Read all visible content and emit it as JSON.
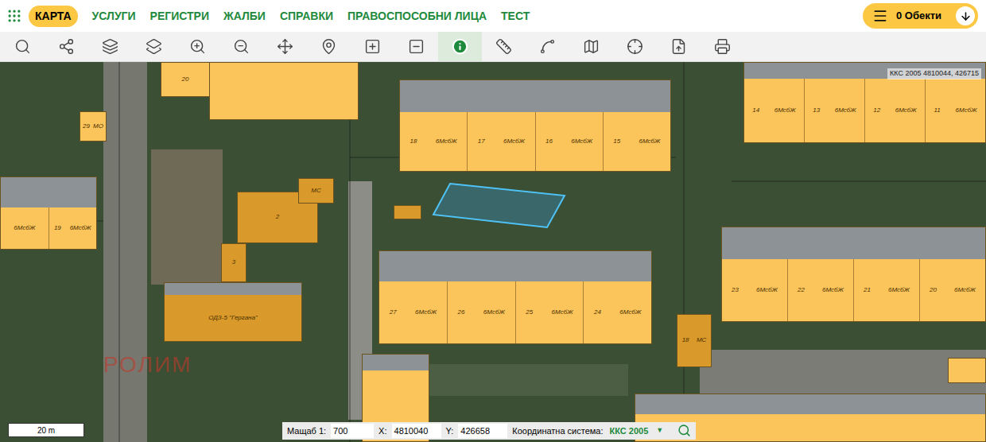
{
  "nav": {
    "items": [
      {
        "label": "КАРТА",
        "selected": true
      },
      {
        "label": "УСЛУГИ",
        "selected": false
      },
      {
        "label": "РЕГИСТРИ",
        "selected": false
      },
      {
        "label": "ЖАЛБИ",
        "selected": false
      },
      {
        "label": "СПРАВКИ",
        "selected": false
      },
      {
        "label": "ПРАВОСПОСОБНИ ЛИЦА",
        "selected": false
      },
      {
        "label": "ТЕСТ",
        "selected": false
      }
    ],
    "objects_button": {
      "label": "0 Обекти"
    }
  },
  "toolbar": {
    "tools": [
      {
        "selected": false
      },
      {
        "selected": false
      },
      {
        "selected": false
      },
      {
        "selected": false
      },
      {
        "selected": false
      },
      {
        "selected": false
      },
      {
        "selected": false
      },
      {
        "selected": false
      },
      {
        "selected": false
      },
      {
        "selected": false
      },
      {
        "selected": true
      },
      {
        "selected": false
      },
      {
        "selected": false
      },
      {
        "selected": false
      },
      {
        "selected": false
      },
      {
        "selected": false
      },
      {
        "selected": false
      }
    ]
  },
  "map": {
    "coordinates": "ККС 2005 4810044, 426715",
    "watermark": "РОЛИМ",
    "selected_parcel": {
      "highlighted": true
    },
    "buildings": [
      {
        "kind": "residential",
        "sections": [
          {
            "texts": [
              "18",
              "6МсбЖ"
            ]
          },
          {
            "texts": [
              "17",
              "6МсбЖ"
            ]
          },
          {
            "texts": [
              "16",
              "6МсбЖ"
            ]
          },
          {
            "texts": [
              "15",
              "6МсбЖ"
            ]
          }
        ]
      },
      {
        "kind": "residential",
        "sections": [
          {
            "texts": [
              "14",
              "6МсбЖ"
            ]
          },
          {
            "texts": [
              "13",
              "6МсбЖ"
            ]
          },
          {
            "texts": [
              "12",
              "6МсбЖ"
            ]
          },
          {
            "texts": [
              "11",
              "6МсбЖ"
            ]
          }
        ]
      },
      {
        "kind": "residential",
        "sections": [
          {
            "texts": [
              "6МсбЖ"
            ]
          },
          {
            "texts": [
              "19",
              "6МсбЖ"
            ]
          }
        ]
      },
      {
        "kind": "residential",
        "sections": [
          {
            "texts": [
              "27",
              "6МсбЖ"
            ]
          },
          {
            "texts": [
              "26",
              "6МсбЖ"
            ]
          },
          {
            "texts": [
              "25",
              "6МсбЖ"
            ]
          },
          {
            "texts": [
              "24",
              "6МсбЖ"
            ]
          }
        ]
      },
      {
        "kind": "residential",
        "sections": [
          {
            "texts": [
              "23",
              "6МсбЖ"
            ]
          },
          {
            "texts": [
              "22",
              "6МсбЖ"
            ]
          },
          {
            "texts": [
              "21",
              "6МсбЖ"
            ]
          },
          {
            "texts": [
              "20",
              "6МсбЖ"
            ]
          }
        ]
      },
      {
        "kind": "residential",
        "sections": []
      },
      {
        "kind": "residential",
        "sections": [
          {
            "texts": [
              "20"
            ]
          }
        ]
      },
      {
        "kind": "residential",
        "sections": [
          {
            "texts": [
              "29",
              "МО"
            ]
          }
        ]
      },
      {
        "kind": "public",
        "sections": [
          {
            "texts": [
              "2"
            ]
          }
        ]
      },
      {
        "kind": "public",
        "sections": [
          {
            "texts": [
              "МС"
            ]
          }
        ]
      },
      {
        "kind": "public",
        "sections": [
          {
            "texts": [
              "3"
            ]
          }
        ]
      },
      {
        "kind": "public",
        "sections": [
          {
            "texts": [
              "ОДЗ-5 \"Гергана\""
            ]
          }
        ]
      },
      {
        "kind": "public",
        "sections": []
      },
      {
        "kind": "public",
        "sections": [
          {
            "texts": [
              "18",
              "МС"
            ]
          }
        ]
      },
      {
        "kind": "residential",
        "sections": []
      },
      {
        "kind": "residential",
        "sections": []
      },
      {
        "kind": "residential",
        "sections": []
      }
    ]
  },
  "status_bar": {
    "scale_bar": "20 m",
    "scale_label": "Мащаб 1:",
    "scale_value": "700",
    "x_label": "X:",
    "x_value": "4810040",
    "y_label": "Y:",
    "y_value": "426658",
    "crs_label": "Координатна система:",
    "crs_value": "ККС 2005",
    "crs_arrow": "▼"
  }
}
